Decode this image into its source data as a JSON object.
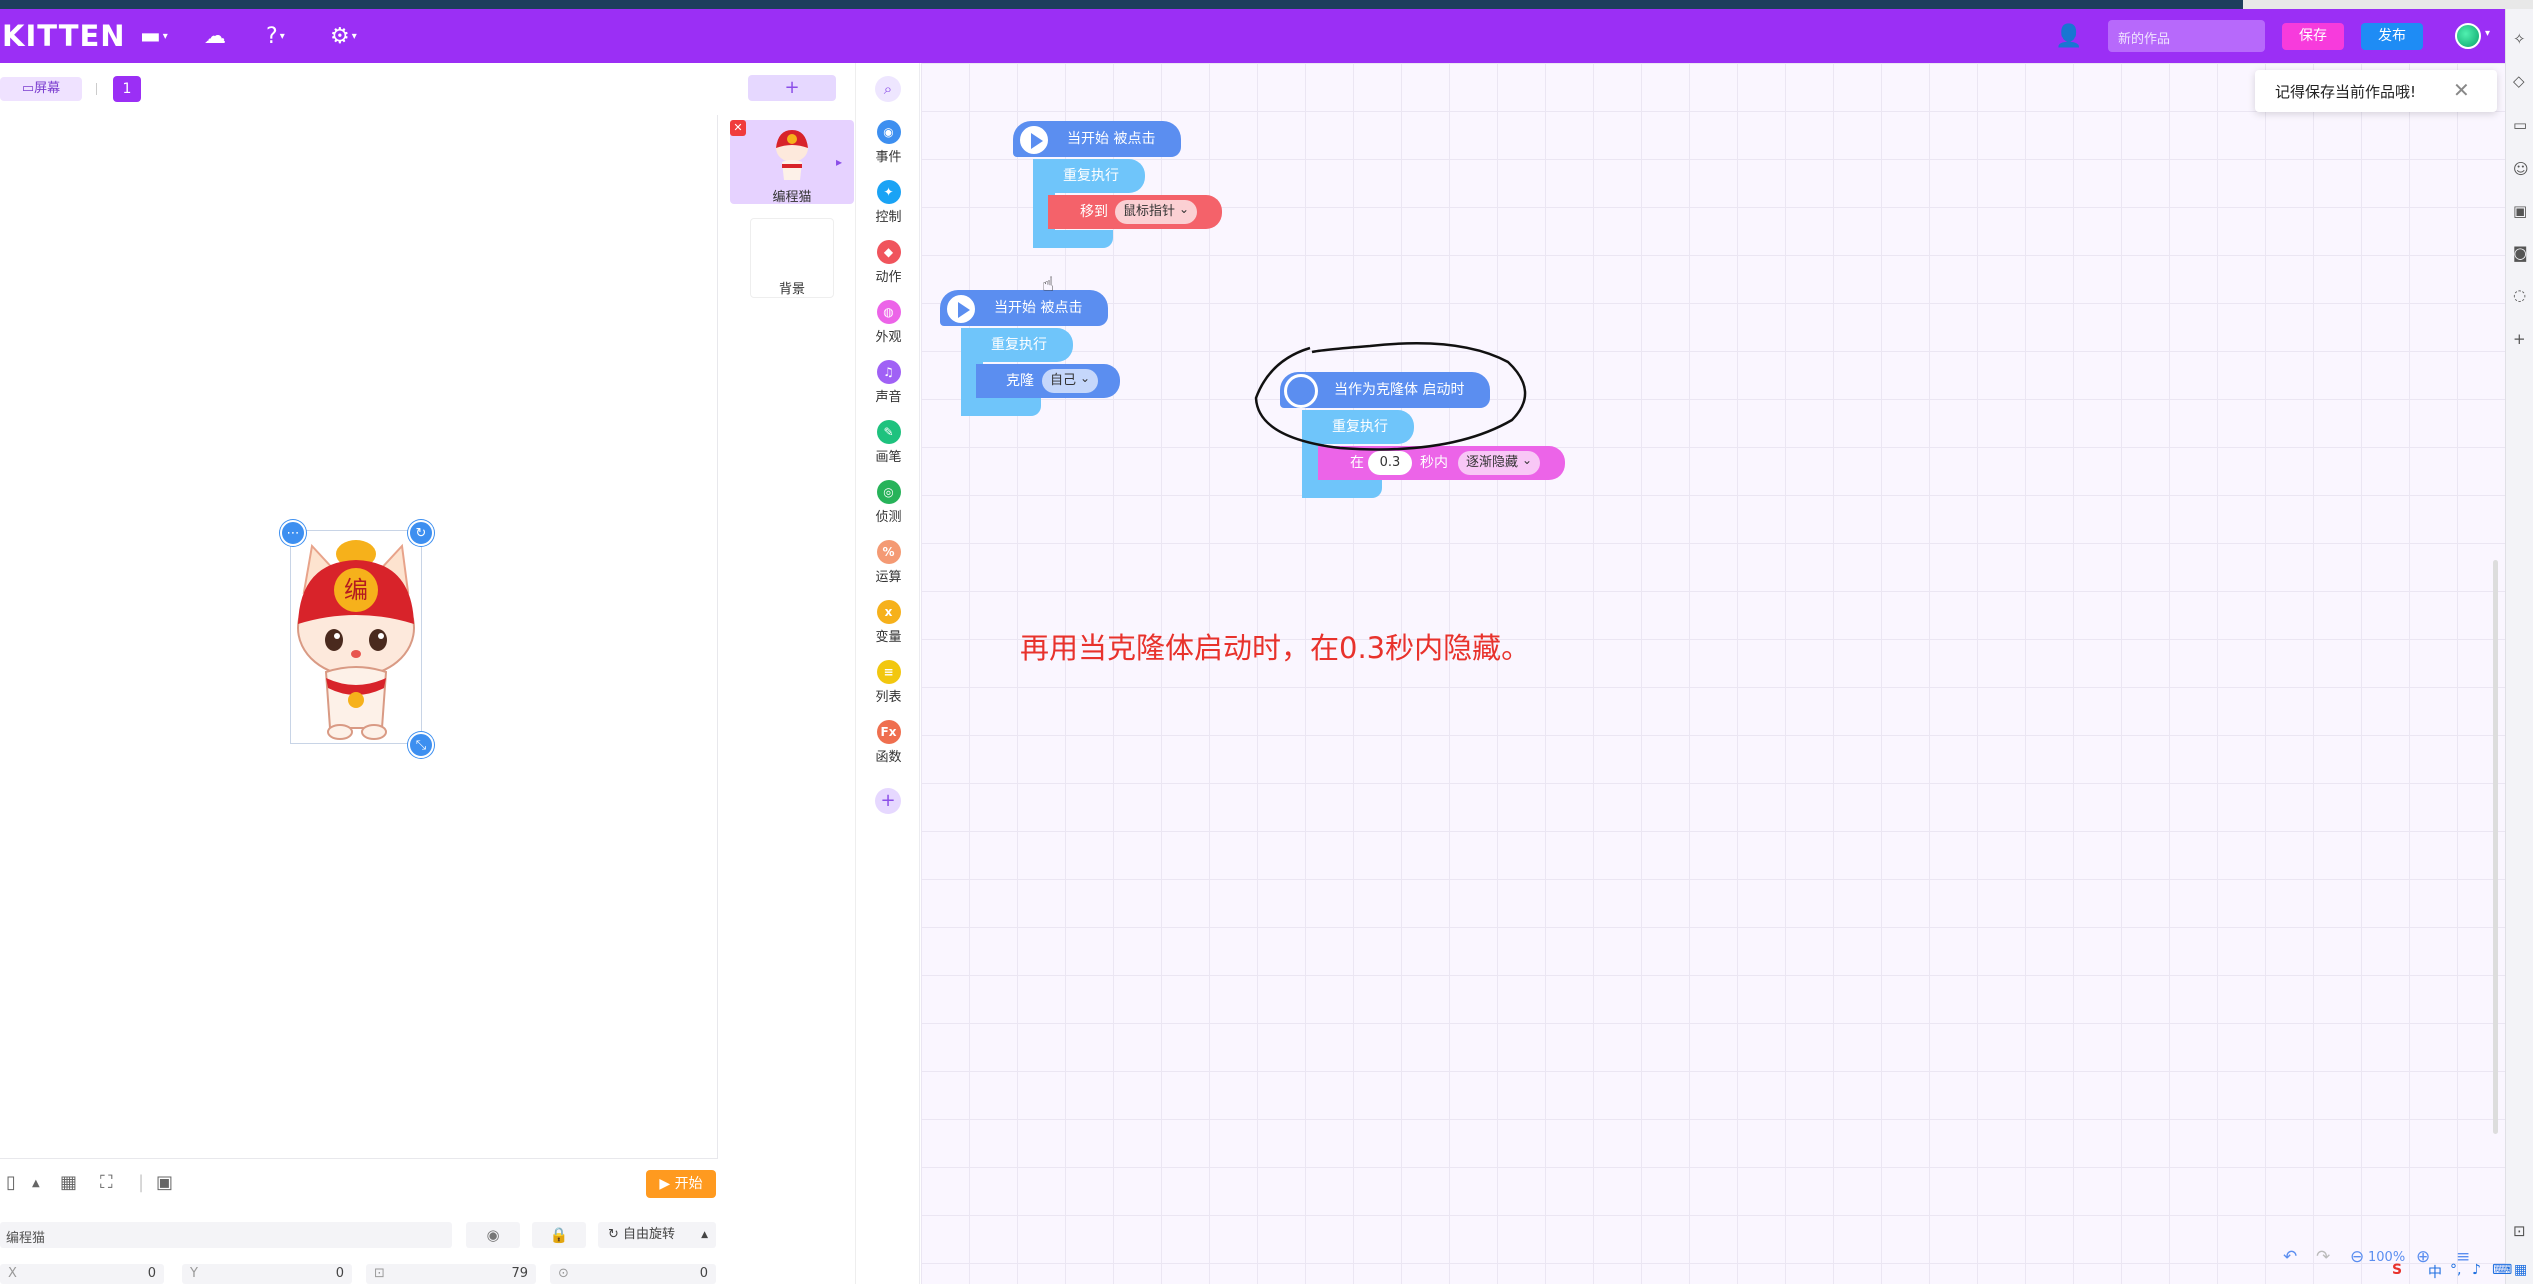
{
  "header": {
    "logo": "KITTEN",
    "new_work_placeholder": "新的作品",
    "save_label": "保存",
    "publish_label": "发布"
  },
  "stage": {
    "screen_label": "屏幕",
    "page_number": "1",
    "start_label": "开始"
  },
  "properties": {
    "name": "编程猫",
    "rotation_label": "自由旋转",
    "x_label": "X",
    "x_value": "0",
    "y_label": "Y",
    "y_value": "0",
    "size_value": "79",
    "direction_value": "0"
  },
  "sprites": {
    "add_label": "+",
    "sprite_name": "编程猫",
    "background_label": "背景"
  },
  "categories": [
    {
      "label": "事件",
      "color": "#3d8ff0",
      "glyph": "◉"
    },
    {
      "label": "控制",
      "color": "#1aa3f5",
      "glyph": "✦"
    },
    {
      "label": "动作",
      "color": "#f0545c",
      "glyph": "◆"
    },
    {
      "label": "外观",
      "color": "#ec64e8",
      "glyph": "◍"
    },
    {
      "label": "声音",
      "color": "#a061f5",
      "glyph": "♫"
    },
    {
      "label": "画笔",
      "color": "#1ec27e",
      "glyph": "✎"
    },
    {
      "label": "侦测",
      "color": "#27b35a",
      "glyph": "◎"
    },
    {
      "label": "运算",
      "color": "#f49a74",
      "glyph": "%"
    },
    {
      "label": "变量",
      "color": "#f6b11b",
      "glyph": "x"
    },
    {
      "label": "列表",
      "color": "#f2c70f",
      "glyph": "≡"
    },
    {
      "label": "函数",
      "color": "#ef6f4f",
      "glyph": "Fx"
    }
  ],
  "blocks": {
    "group1": {
      "hat": "当开始 被点击",
      "loop": "重复执行",
      "motion": "移到",
      "motion_target": "鼠标指针"
    },
    "group2": {
      "hat": "当开始 被点击",
      "loop": "重复执行",
      "clone": "克隆",
      "clone_target": "自己"
    },
    "group3": {
      "hat": "当作为克隆体 启动时",
      "loop": "重复执行",
      "in_label": "在",
      "seconds_value": "0.3",
      "seconds_label": "秒内",
      "effect": "逐渐隐藏"
    }
  },
  "annotation": "再用当克隆体启动时，在0.3秒内隐藏。",
  "toast": {
    "message": "记得保存当前作品哦!"
  },
  "zoom": "100%"
}
